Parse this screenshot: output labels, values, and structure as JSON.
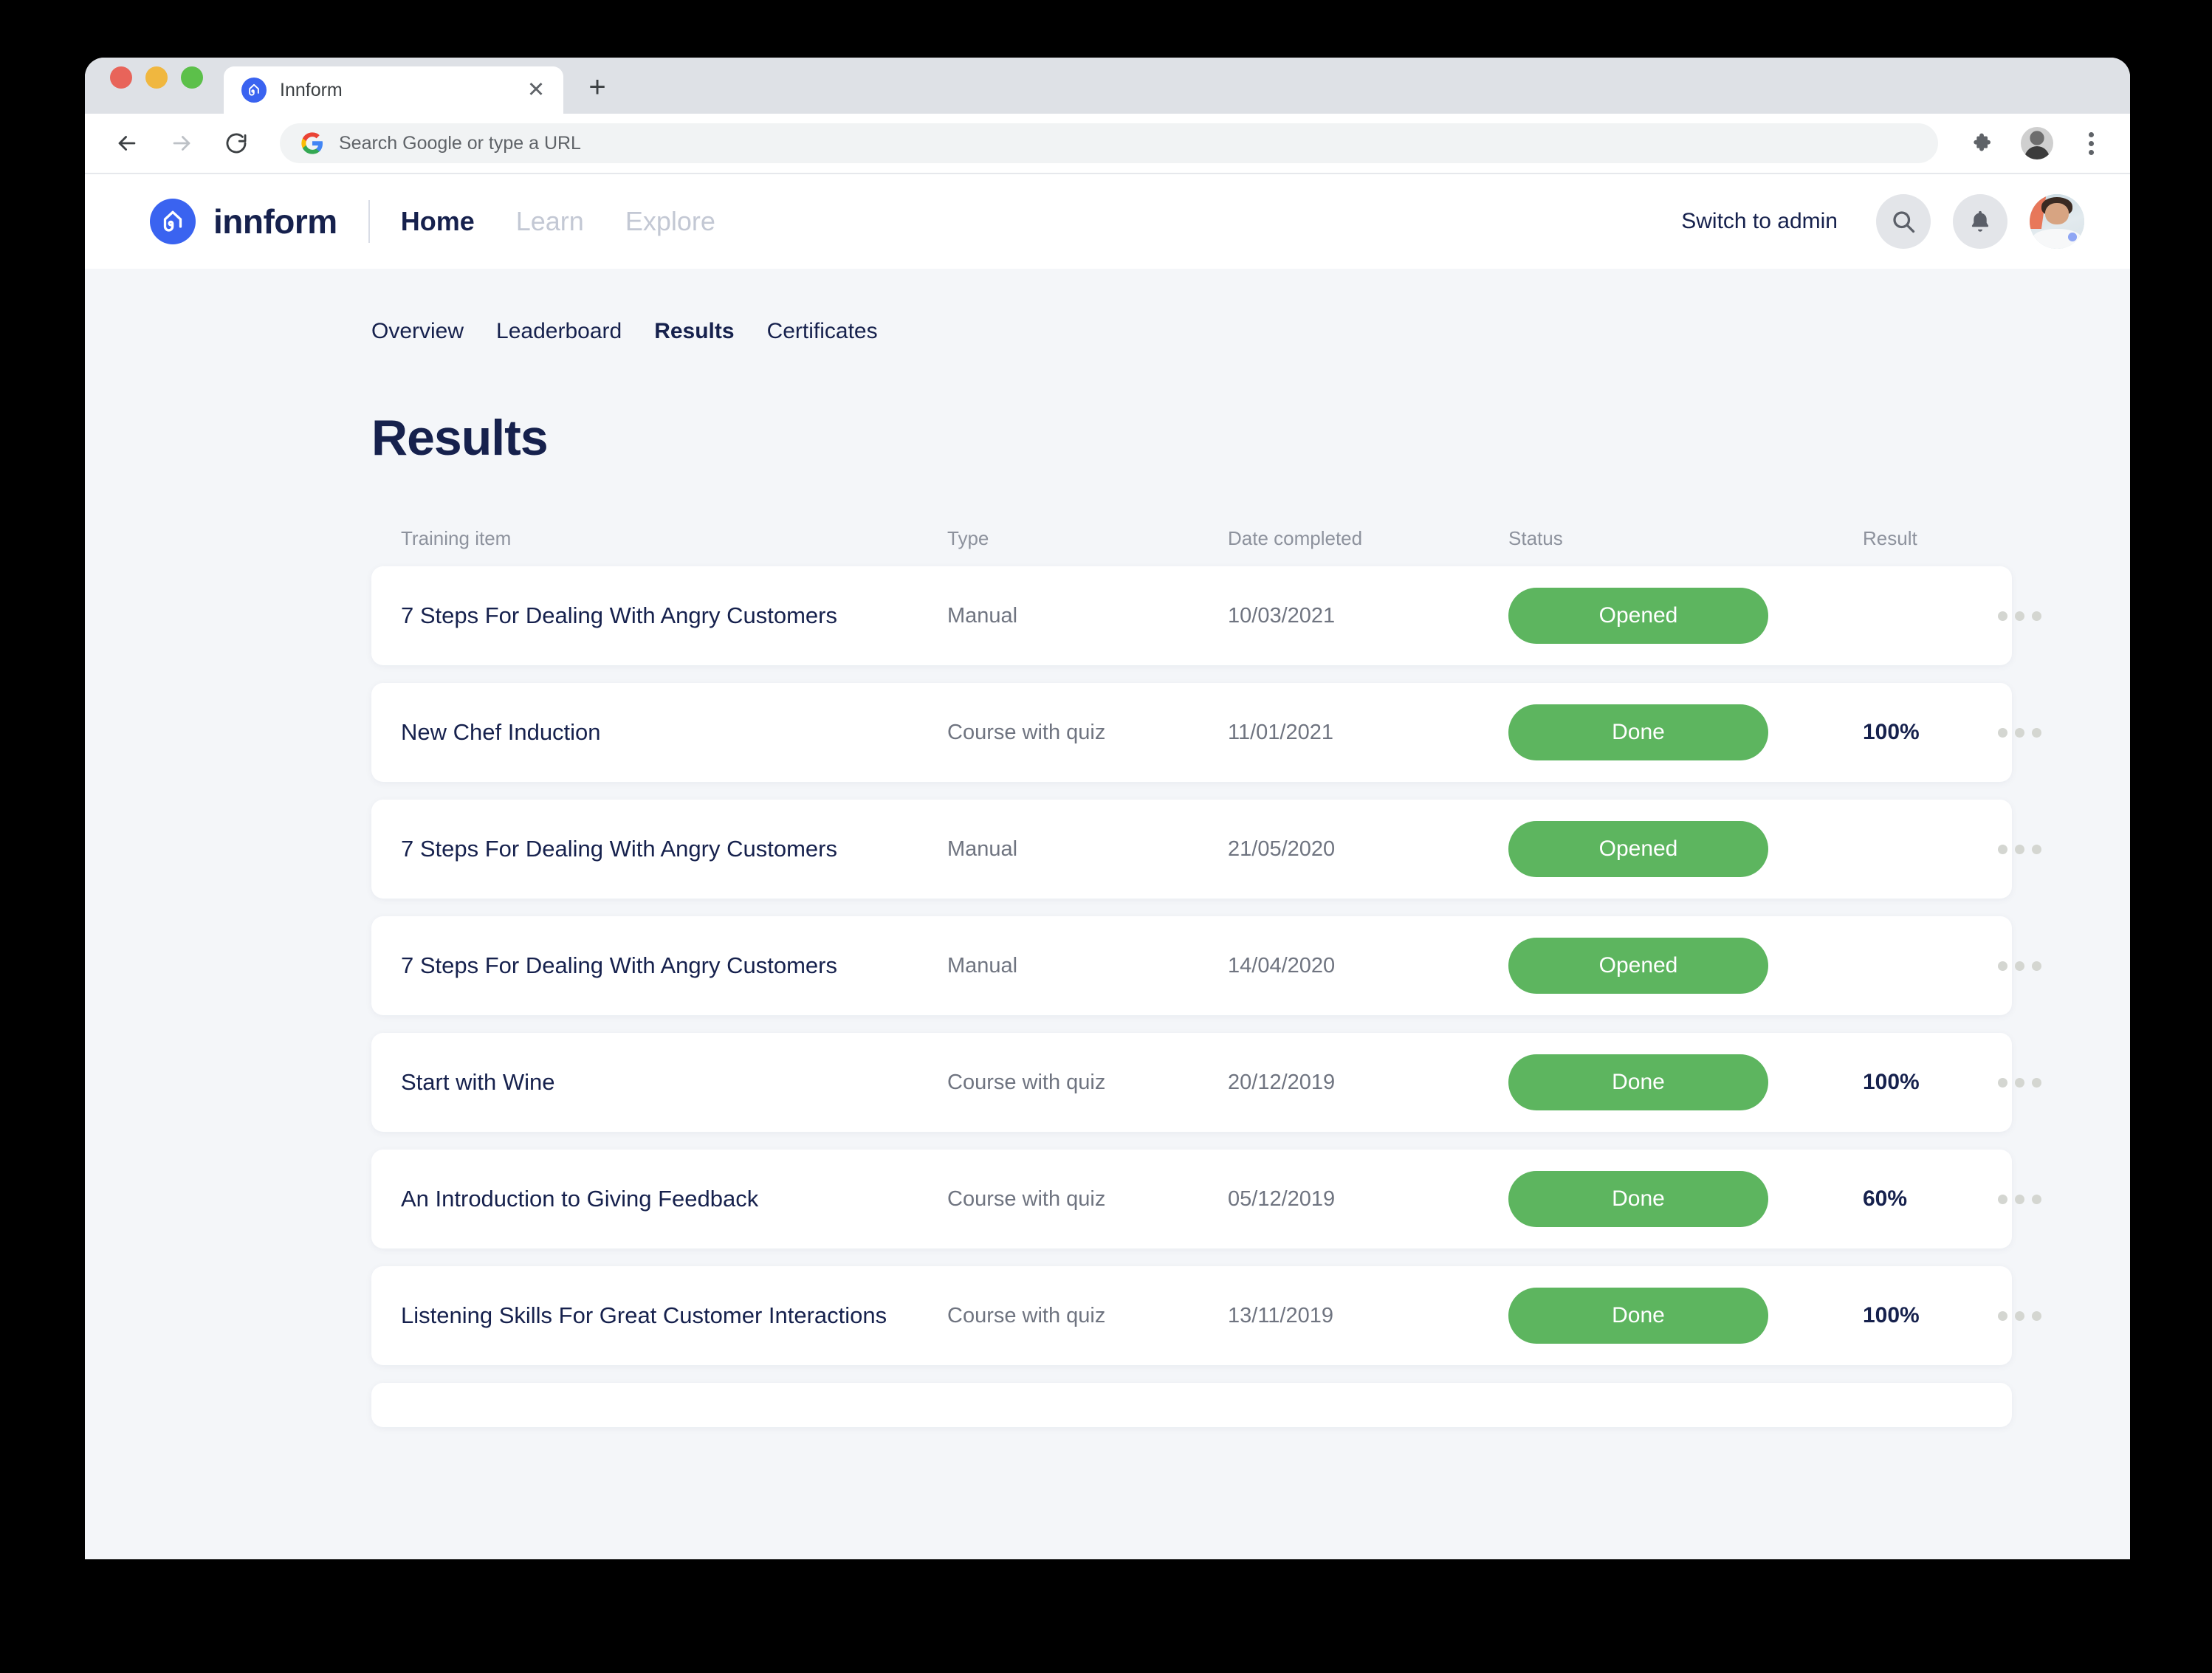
{
  "browser": {
    "tab": {
      "title": "Innform",
      "favicon_icon": "innform-logo-icon",
      "close_icon": "close-icon"
    },
    "new_tab_icon": "plus-icon",
    "back_icon": "arrow-left-icon",
    "forward_icon": "arrow-right-icon",
    "reload_icon": "reload-icon",
    "omnibox": {
      "text": "Search Google or type a URL",
      "search_icon": "google-g-icon"
    },
    "extensions_icon": "puzzle-piece-icon",
    "profile_icon": "chrome-profile-avatar",
    "menu_icon": "three-dots-vertical-icon"
  },
  "app_header": {
    "brand_name": "innform",
    "brand_icon": "innform-house-icon",
    "nav": [
      {
        "label": "Home",
        "active": true
      },
      {
        "label": "Learn",
        "active": false
      },
      {
        "label": "Explore",
        "active": false
      }
    ],
    "switch_to_admin": "Switch to admin",
    "search_icon": "search-icon",
    "notifications_icon": "bell-icon",
    "avatar": "user-avatar"
  },
  "sub_nav": [
    {
      "label": "Overview",
      "active": false
    },
    {
      "label": "Leaderboard",
      "active": false
    },
    {
      "label": "Results",
      "active": true
    },
    {
      "label": "Certificates",
      "active": false
    }
  ],
  "page": {
    "title": "Results"
  },
  "table": {
    "columns": [
      "Training item",
      "Type",
      "Date completed",
      "Status",
      "Result"
    ],
    "row_menu_icon": "kebab-menu-icon",
    "rows": [
      {
        "title": "7 Steps For Dealing With Angry Customers",
        "type": "Manual",
        "date": "10/03/2021",
        "status": "Opened",
        "result": ""
      },
      {
        "title": "New Chef Induction",
        "type": "Course with quiz",
        "date": "11/01/2021",
        "status": "Done",
        "result": "100%"
      },
      {
        "title": "7 Steps For Dealing With Angry Customers",
        "type": "Manual",
        "date": "21/05/2020",
        "status": "Opened",
        "result": ""
      },
      {
        "title": "7 Steps For Dealing With Angry Customers",
        "type": "Manual",
        "date": "14/04/2020",
        "status": "Opened",
        "result": ""
      },
      {
        "title": "Start with Wine",
        "type": "Course with quiz",
        "date": "20/12/2019",
        "status": "Done",
        "result": "100%"
      },
      {
        "title": "An Introduction to Giving Feedback",
        "type": "Course with quiz",
        "date": "05/12/2019",
        "status": "Done",
        "result": "60%"
      },
      {
        "title": "Listening Skills For Great Customer Interactions",
        "type": "Course with quiz",
        "date": "13/11/2019",
        "status": "Done",
        "result": "100%"
      }
    ]
  },
  "colors": {
    "brand_blue": "#3a63f0",
    "navy_text": "#16214d",
    "status_green": "#5db55f",
    "page_background": "#f4f6f9",
    "card_white": "#ffffff",
    "muted_text": "#6f7480"
  }
}
